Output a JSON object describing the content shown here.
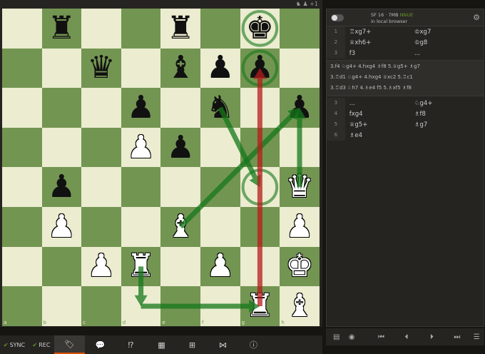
{
  "top_icons": "♞ ♟ +1",
  "files": [
    "a",
    "b",
    "c",
    "d",
    "e",
    "f",
    "g",
    "h"
  ],
  "ranks": [
    "8",
    "7",
    "6",
    "5",
    "4",
    "3",
    "2",
    "1"
  ],
  "pieces": [
    {
      "sq": "b8",
      "g": "♜",
      "c": "b",
      "name": "black-rook-piece"
    },
    {
      "sq": "e8",
      "g": "♜",
      "c": "b",
      "name": "black-rook-piece"
    },
    {
      "sq": "g8",
      "g": "♚",
      "c": "b",
      "name": "black-king-piece"
    },
    {
      "sq": "c7",
      "g": "♛",
      "c": "b",
      "name": "black-queen-piece"
    },
    {
      "sq": "e7",
      "g": "♝",
      "c": "b",
      "name": "black-bishop-piece"
    },
    {
      "sq": "f7",
      "g": "♟",
      "c": "b",
      "name": "black-pawn-piece"
    },
    {
      "sq": "g7",
      "g": "♟",
      "c": "b",
      "name": "black-pawn-piece"
    },
    {
      "sq": "d6",
      "g": "♟",
      "c": "b",
      "name": "black-pawn-piece"
    },
    {
      "sq": "f6",
      "g": "♞",
      "c": "b",
      "name": "black-knight-piece"
    },
    {
      "sq": "h6",
      "g": "♟",
      "c": "b",
      "name": "black-pawn-piece"
    },
    {
      "sq": "d5",
      "g": "♟",
      "c": "w",
      "name": "white-pawn-piece"
    },
    {
      "sq": "e5",
      "g": "♟",
      "c": "b",
      "name": "black-pawn-piece"
    },
    {
      "sq": "b4",
      "g": "♟",
      "c": "b",
      "name": "black-pawn-piece"
    },
    {
      "sq": "h4",
      "g": "♛",
      "c": "w",
      "name": "white-queen-piece"
    },
    {
      "sq": "b3",
      "g": "♟",
      "c": "w",
      "name": "white-pawn-piece"
    },
    {
      "sq": "e3",
      "g": "♝",
      "c": "w",
      "name": "white-bishop-piece"
    },
    {
      "sq": "h3",
      "g": "♟",
      "c": "w",
      "name": "white-pawn-piece"
    },
    {
      "sq": "c2",
      "g": "♟",
      "c": "w",
      "name": "white-pawn-piece"
    },
    {
      "sq": "d2",
      "g": "♜",
      "c": "w",
      "name": "white-rook-piece"
    },
    {
      "sq": "f2",
      "g": "♟",
      "c": "w",
      "name": "white-pawn-piece"
    },
    {
      "sq": "h2",
      "g": "♚",
      "c": "w",
      "name": "white-king-piece"
    },
    {
      "sq": "g1",
      "g": "♜",
      "c": "w",
      "name": "white-rook-piece"
    },
    {
      "sq": "h1",
      "g": "♝",
      "c": "w",
      "name": "white-bishop-piece"
    }
  ],
  "arrows": [
    {
      "from": "d2",
      "to": "d1",
      "color": "#15781b",
      "name": "green-arrow-d2-d1"
    },
    {
      "from": "d1",
      "to": "g1",
      "color": "#15781b",
      "name": "green-arrow-d1-g1"
    },
    {
      "from": "e3",
      "to": "h6",
      "color": "#15781b",
      "name": "green-arrow-e3-h6"
    },
    {
      "from": "f6",
      "to": "g4",
      "color": "#15781b",
      "name": "green-arrow-f6-g4"
    },
    {
      "from": "h4",
      "to": "h6",
      "color": "#15781b",
      "name": "green-arrow-h4-h6"
    },
    {
      "from": "g1",
      "to": "g7",
      "color": "#b71c1c",
      "name": "red-arrow-g1-g7"
    }
  ],
  "circles": [
    {
      "sq": "g8",
      "color": "#15781b",
      "name": "green-circle-g8"
    },
    {
      "sq": "g7",
      "color": "#15781b",
      "name": "green-circle-g7"
    },
    {
      "sq": "g4",
      "color": "#15781b",
      "name": "green-circle-g4"
    }
  ],
  "bottom_bar": {
    "sync": "SYNC",
    "rec": "REC",
    "items": [
      {
        "name": "tag-icon",
        "glyph": "🏷"
      },
      {
        "name": "comment-icon",
        "glyph": "💬"
      },
      {
        "name": "annotation-icon",
        "glyph": "⁉"
      },
      {
        "name": "chart-icon",
        "glyph": "▦"
      },
      {
        "name": "grid-icon",
        "glyph": "⊞"
      },
      {
        "name": "share-icon",
        "glyph": "⋈"
      },
      {
        "name": "info-icon",
        "glyph": "ⓘ"
      }
    ]
  },
  "engine": {
    "name": "SF 16 · 7MB",
    "nnue": "NNUE",
    "location": "in local browser"
  },
  "moves_top": [
    {
      "n": "1",
      "w": "♖xg7+",
      "b": "♔xg7"
    },
    {
      "n": "2",
      "w": "♕xh6+",
      "b": "♔g8"
    },
    {
      "n": "3",
      "w": "f3",
      "b": "..."
    }
  ],
  "lines": [
    "3.f4 ♘g4+ 4.hxg4 ♗f8 5.♕g5+ ♗g7",
    "3.♖d1 ♘g4+ 4.hxg4 ♕xc2 5.♖c1",
    "3.♖d3 ♘h7 4.♗e4 f5 5.♗xf5 ♗f8"
  ],
  "moves_bottom": [
    {
      "n": "3",
      "w": "...",
      "b": "♘g4+"
    },
    {
      "n": "4",
      "w": "fxg4",
      "b": "♗f8"
    },
    {
      "n": "5",
      "w": "♕g5+",
      "b": "♗g7"
    },
    {
      "n": "6",
      "w": "♗e4",
      "b": ""
    }
  ],
  "nav": {
    "book": "▤",
    "record": "◉",
    "first": "⏮",
    "prev": "⏴",
    "next": "⏵",
    "last": "⏭",
    "menu": "☰"
  }
}
